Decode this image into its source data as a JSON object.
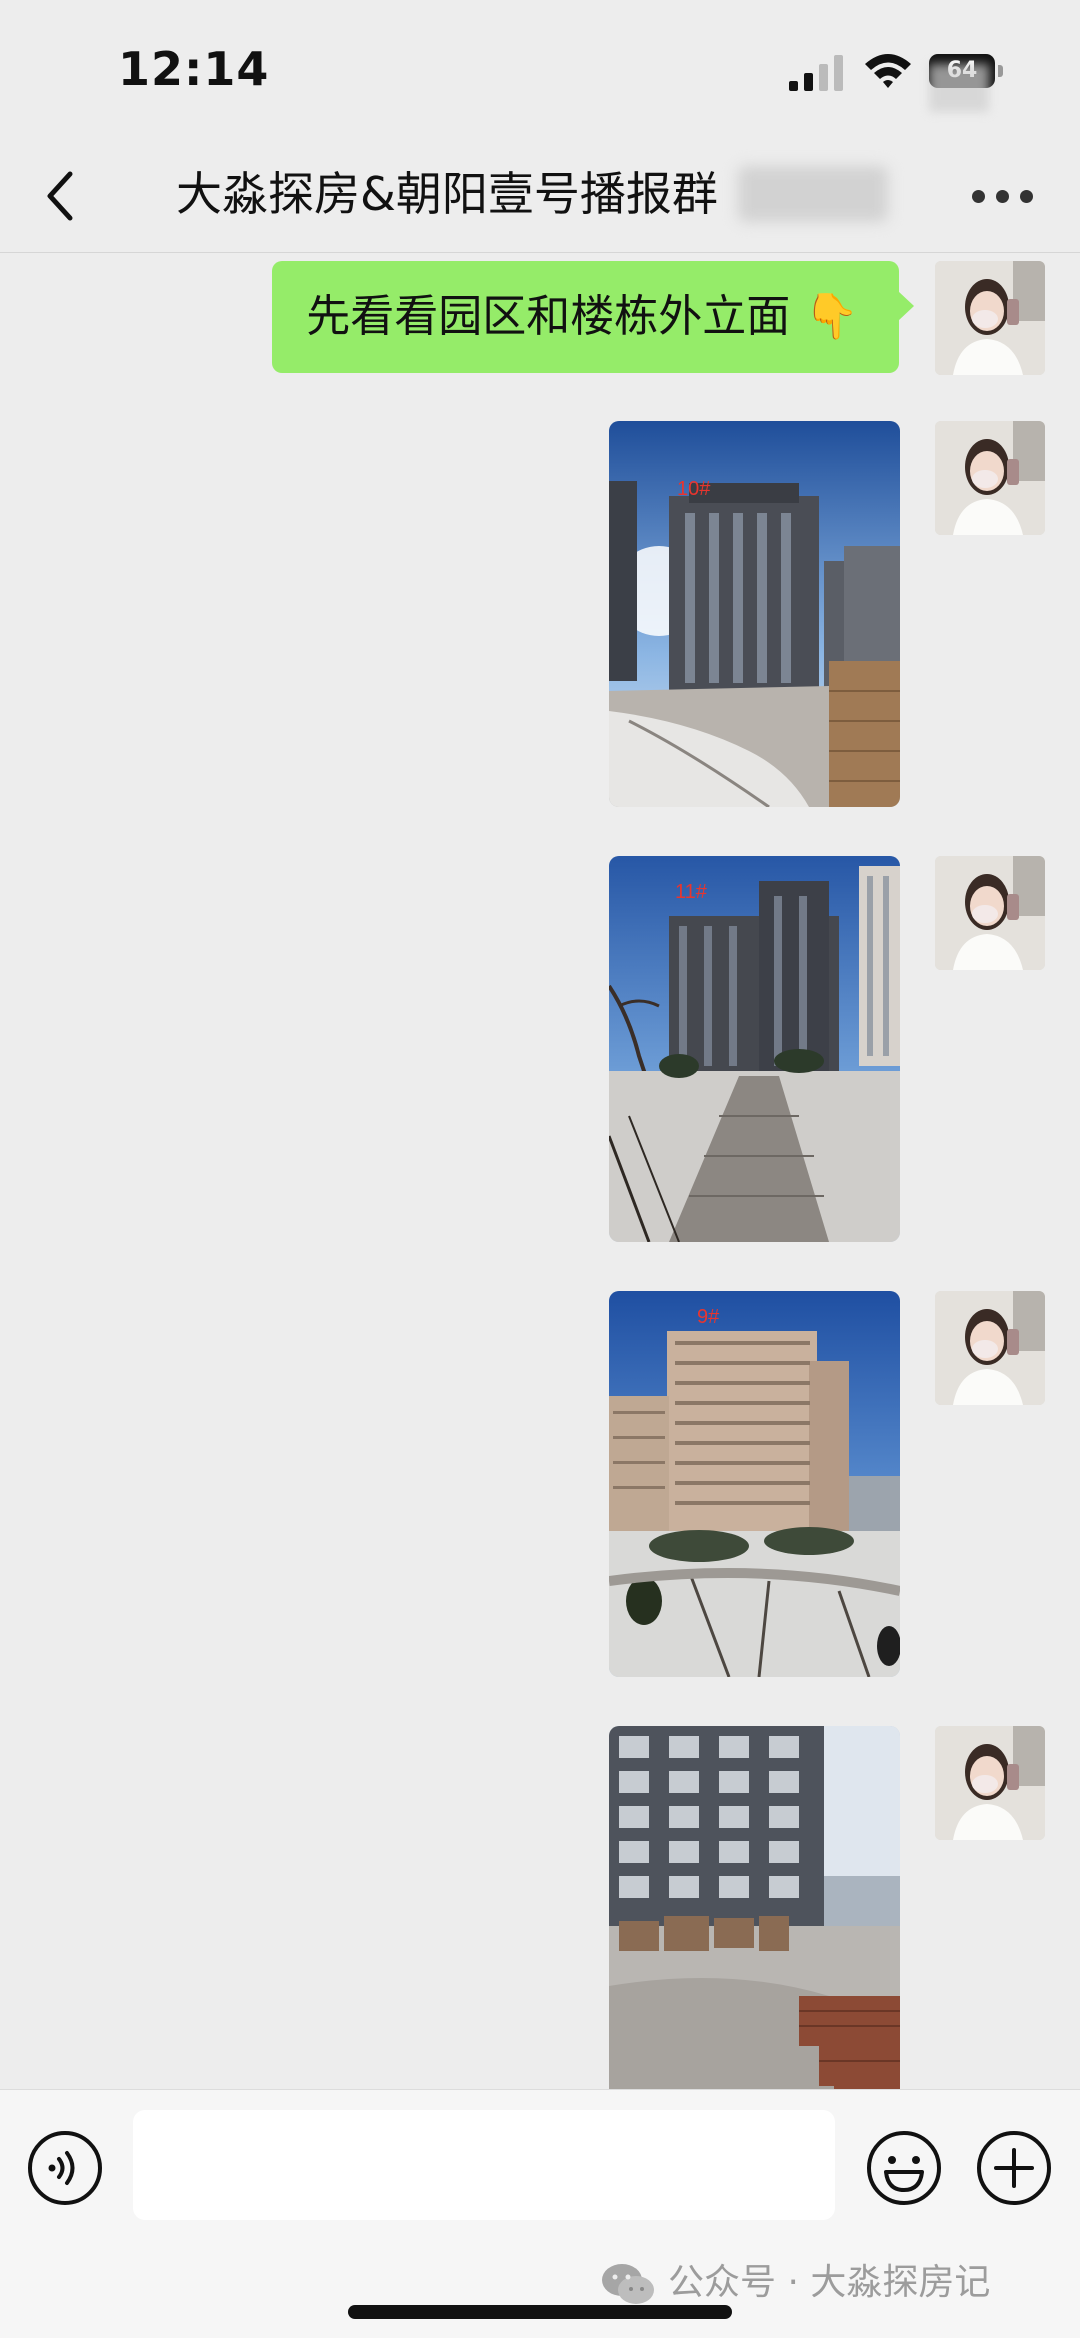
{
  "status_bar": {
    "time": "12:14",
    "battery": "64"
  },
  "header": {
    "back_icon": "chevron-left-icon",
    "title": "大淼探房&朝阳壹号播报群",
    "more_icon": "ellipsis-icon"
  },
  "messages": [
    {
      "type": "text",
      "text": "先看看园区和楼栋外立面 👇",
      "sender": "self"
    },
    {
      "type": "image",
      "label": "10#",
      "sender": "self"
    },
    {
      "type": "image",
      "label": "11#",
      "sender": "self"
    },
    {
      "type": "image",
      "label": "9#",
      "sender": "self"
    },
    {
      "type": "image",
      "label": "",
      "sender": "self"
    }
  ],
  "input_bar": {
    "voice_icon": "voice-icon",
    "input_value": "",
    "emoji_icon": "emoji-icon",
    "plus_icon": "plus-icon"
  },
  "watermark": {
    "text": "公众号 · 大淼探房记",
    "icon": "wechat-icon"
  },
  "colors": {
    "bubble_self": "#95ec69",
    "background": "#ededed",
    "photo_label": "#e8352e"
  }
}
